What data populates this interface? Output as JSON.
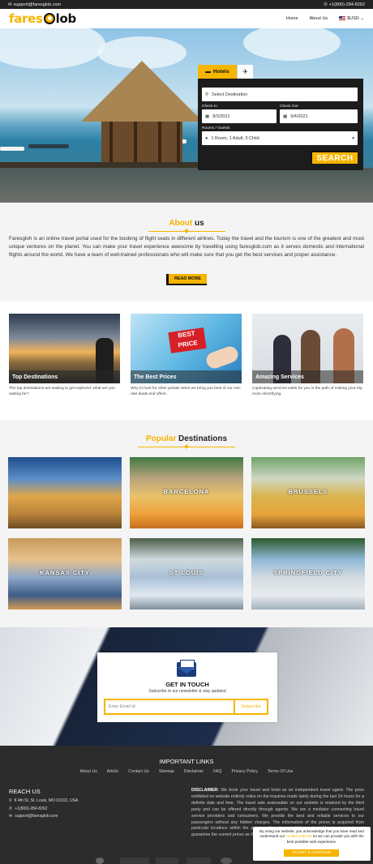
{
  "topbar": {
    "email": "support@faresglob.com",
    "phone": "+1(800)-284-8262"
  },
  "brand": {
    "logo_left": "fares",
    "logo_right": "lob"
  },
  "nav": {
    "home": "Home",
    "about": "About Us",
    "currency": "$USD"
  },
  "booking": {
    "tab_hotels": "Hotels",
    "destination_placeholder": "Select Destination",
    "checkin_label": "Check In",
    "checkin_value": "8/3/2021",
    "checkout_label": "Check Out",
    "checkout_value": "9/4/2021",
    "rooms_label": "Rooms / Guests",
    "rooms_value": "1 Room, 1 Adult, 0 Child",
    "search_label": "SEARCH"
  },
  "about": {
    "title_highlight": "About",
    "title_rest": "us",
    "paragraph": "Faresgloh is an online travel portal used for the booking of flight seats in different airlines. Today the travel and the tourism is one of the greatest and most unique ventures on the planet. You can make your travel experience awesome by travelling using faresglob.com as it serves domestic and international flights around the world. We have a team of well-trained professionals who will make sure that you get the best services and proper assistance.",
    "read_more": "READ MORE"
  },
  "services": [
    {
      "title": "Top Destinations",
      "text": "The top destinations are waiting to get explored. what are you waiting for?"
    },
    {
      "title": "The Best Prices",
      "text": "Why to hunt for other portals when we bring you best of our exit-rate deals and offers."
    },
    {
      "title": "Amazing Services",
      "text": "Captivating services waits for you in the path of making your trip more electrifying."
    }
  ],
  "price_badge": {
    "line1": "BEST",
    "line2": "PRICE"
  },
  "popular": {
    "title_highlight": "Popular",
    "title_rest": "Destinations",
    "cities": [
      "",
      "BARCELONA",
      "BRUSSELS",
      "KANSAS CITY",
      "ST LOUIS",
      "SPRINGFIELD CITY"
    ]
  },
  "newsletter": {
    "title": "GET IN TOUCH",
    "subtitle": "Subscribe to our newsletter & stay updated",
    "email_placeholder": "Enter Email Id",
    "subscribe": "Subscribe"
  },
  "footer": {
    "important_links_title": "IMPORTANT LINKS",
    "links": [
      "About Us",
      "Article",
      "Contact Us",
      "Sitemap",
      "Disclaimer",
      "FAQ",
      "Privacy Policy",
      "Terms Of Use"
    ],
    "reach_title": "REACH US",
    "address": "8 4th St, St. Louis, MO 63102, USA",
    "phone": "+1(800)-284-8262",
    "email": "support@faresglob.com",
    "disclaimer_label": "DISCLAIMER:",
    "disclaimer_text": "We book your travel and hotel as an independent travel agent. The price exhibited on website entirely relies on the inquiries made lately during the last 24 hours for a definite date and time. The travel sale assessable on our website is retained by the third party and can be offered directly through agents. We are a mediator connecting travel service providers and consumers. We provide the best and reliable services to our passengers without any hidden charges. The information of the prices is acquired from particular locations within the previous few days, validity content. Moreover, we do not guarantee the current prices as they fluctuate according to the time."
  },
  "cookie": {
    "text_before": "By using our website, you acknowledge that you have read and understand our",
    "link": "cookies policies",
    "text_after": "so we can provide you with the best possible web experience.",
    "accept": "ACCEPT & CONTINUE"
  },
  "colors": {
    "accent": "#f6b500",
    "dark": "#222222",
    "footer": "#2c2c2c"
  }
}
